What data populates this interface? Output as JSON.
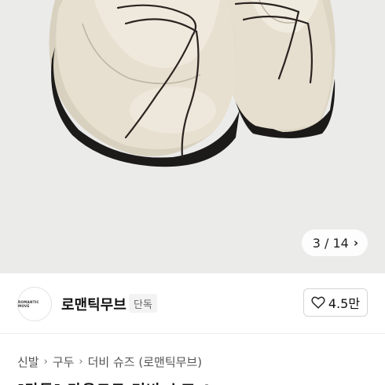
{
  "gallery": {
    "counter_text": "3 / 14",
    "next_icon": "chevron-right-icon",
    "background_color": "#ebebea",
    "product_color": "#e3dccb"
  },
  "seller": {
    "avatar_text": "ROMANTIC MOVE",
    "name": "로맨틱무브",
    "badge": "단독"
  },
  "like": {
    "icon": "heart-outline-icon",
    "count": "4.5만"
  },
  "breadcrumb": {
    "items": [
      "신발",
      "구두",
      "더비 슈즈 (로맨틱무브)"
    ],
    "separator_icon": "chevron-right-icon"
  },
  "product": {
    "title_peek": "[단독] 라운드토 더비 슈즈_Ivory"
  }
}
